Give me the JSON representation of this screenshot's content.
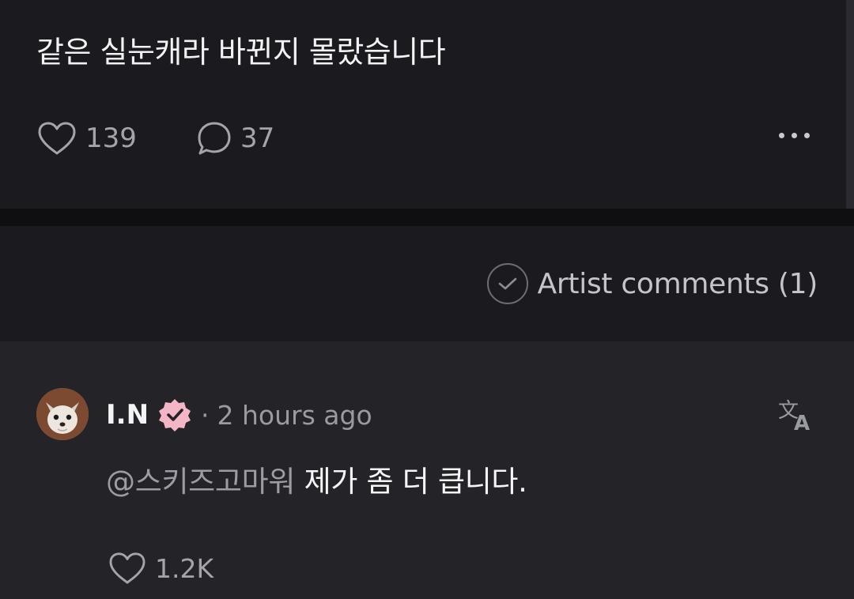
{
  "post": {
    "text": "같은 실눈캐라 바뀐지 몰랐습니다",
    "like_count": "139",
    "comment_count": "37",
    "icons": {
      "like": "heart-outline-icon",
      "comment": "speech-bubble-icon",
      "more": "ellipsis-horizontal-icon"
    }
  },
  "filter": {
    "label": "Artist comments (1)",
    "icon": "check-circle-icon"
  },
  "comment": {
    "username": "I.N",
    "separator": "·",
    "time": "2 hours ago",
    "mention": "@스키즈고마워",
    "text": "제가 좀 더 큽니다.",
    "like_count": "1.2K",
    "icons": {
      "verified": "verified-badge-icon",
      "translate": "translate-icon",
      "like": "heart-outline-icon",
      "avatar": "fox-avatar"
    }
  },
  "colors": {
    "background": "#1b1b1f",
    "comment_background": "#232328",
    "divider": "#0f0f11",
    "verified_badge": "#f4b6c7",
    "muted_text": "#a4a4ab"
  }
}
